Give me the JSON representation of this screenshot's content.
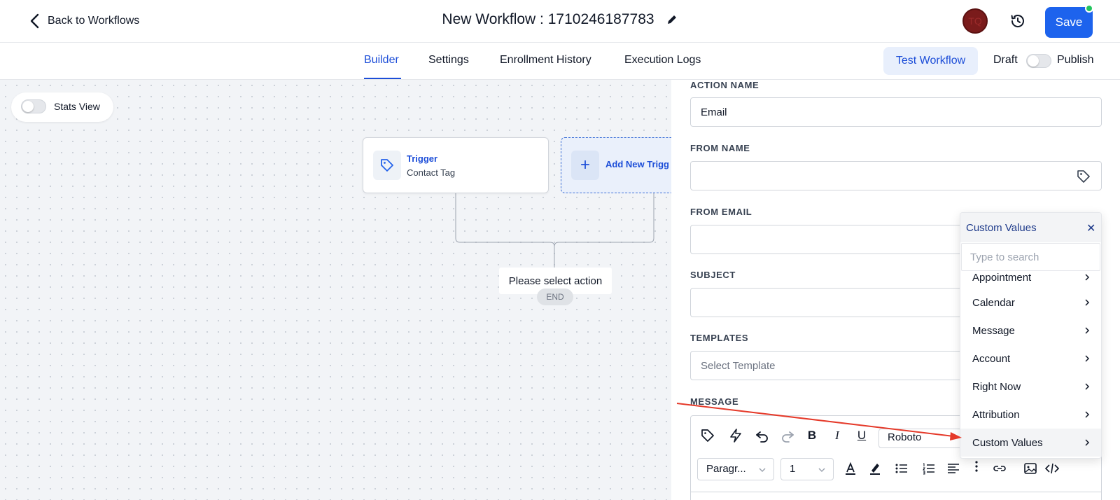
{
  "header": {
    "back_label": "Back to Workflows",
    "title": "New Workflow : 1710246187783",
    "avatar_initials": "TQ",
    "save_label": "Save"
  },
  "tabs": {
    "items": [
      {
        "label": "Builder",
        "active": true
      },
      {
        "label": "Settings",
        "active": false
      },
      {
        "label": "Enrollment History",
        "active": false
      },
      {
        "label": "Execution Logs",
        "active": false
      }
    ],
    "test_label": "Test Workflow",
    "draft_label": "Draft",
    "publish_label": "Publish"
  },
  "canvas": {
    "stats_label": "Stats View",
    "trigger": {
      "title": "Trigger",
      "subtitle": "Contact Tag"
    },
    "add_trigger_label": "Add New Trigg",
    "select_action_label": "Please select action",
    "end_label": "END"
  },
  "form": {
    "action_name_label": "ACTION NAME",
    "action_name_value": "Email",
    "from_name_label": "FROM NAME",
    "from_email_label": "FROM EMAIL",
    "subject_label": "SUBJECT",
    "templates_label": "TEMPLATES",
    "template_placeholder": "Select Template",
    "message_label": "MESSAGE",
    "font_value": "Roboto",
    "paragraph_value": "Paragr...",
    "size_value": "1"
  },
  "custom_values_popup": {
    "title": "Custom Values",
    "close_glyph": "✕",
    "search_placeholder": "Type to search",
    "items": [
      "Appointment",
      "Calendar",
      "Message",
      "Account",
      "Right Now",
      "Attribution",
      "Custom Values"
    ]
  },
  "colors": {
    "accent": "#1d63ed",
    "link": "#1d4ed8",
    "canvas_bg": "#f2f4f7",
    "annotation_arrow": "#e53a2a"
  }
}
